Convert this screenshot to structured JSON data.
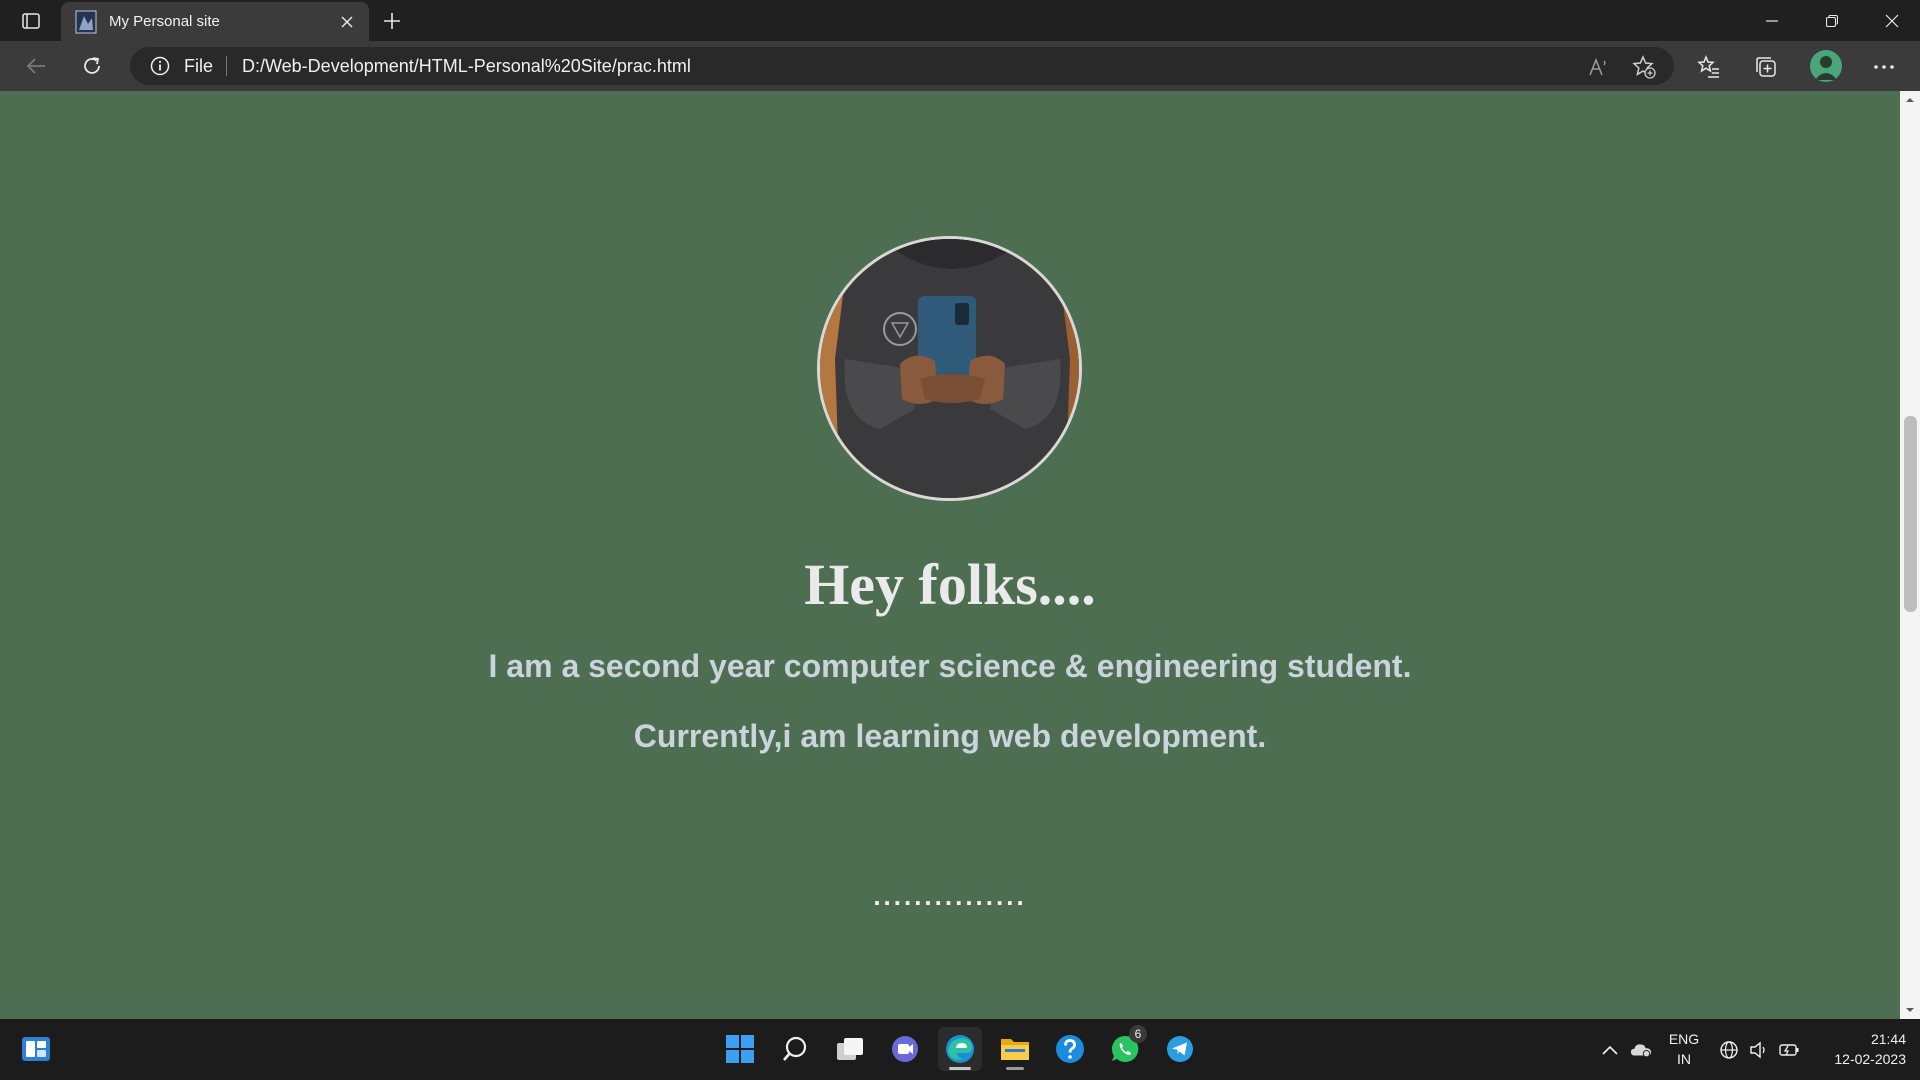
{
  "browser": {
    "tab_title": "My Personal site",
    "address_scheme": "File",
    "url": "D:/Web-Development/HTML-Personal%20Site/prac.html"
  },
  "page": {
    "heading": "Hey folks....",
    "line1": "I am a second year computer science & engineering student.",
    "line2": "Currently,i am learning web development.",
    "dots": "...............",
    "background": "#4e6e51"
  },
  "taskbar": {
    "apps": [
      "start-icon",
      "search-icon",
      "task-view-icon",
      "teams-chat-icon",
      "edge-icon",
      "file-explorer-icon",
      "help-icon",
      "whatsapp-icon",
      "telegram-icon"
    ],
    "whatsapp_badge": "6",
    "lang_line1": "ENG",
    "lang_line2": "IN",
    "time": "21:44",
    "date": "12-02-2023"
  },
  "colors": {
    "accent": "#0078d4",
    "content_bg": "#4e6e51",
    "chrome_bg": "#202020"
  }
}
